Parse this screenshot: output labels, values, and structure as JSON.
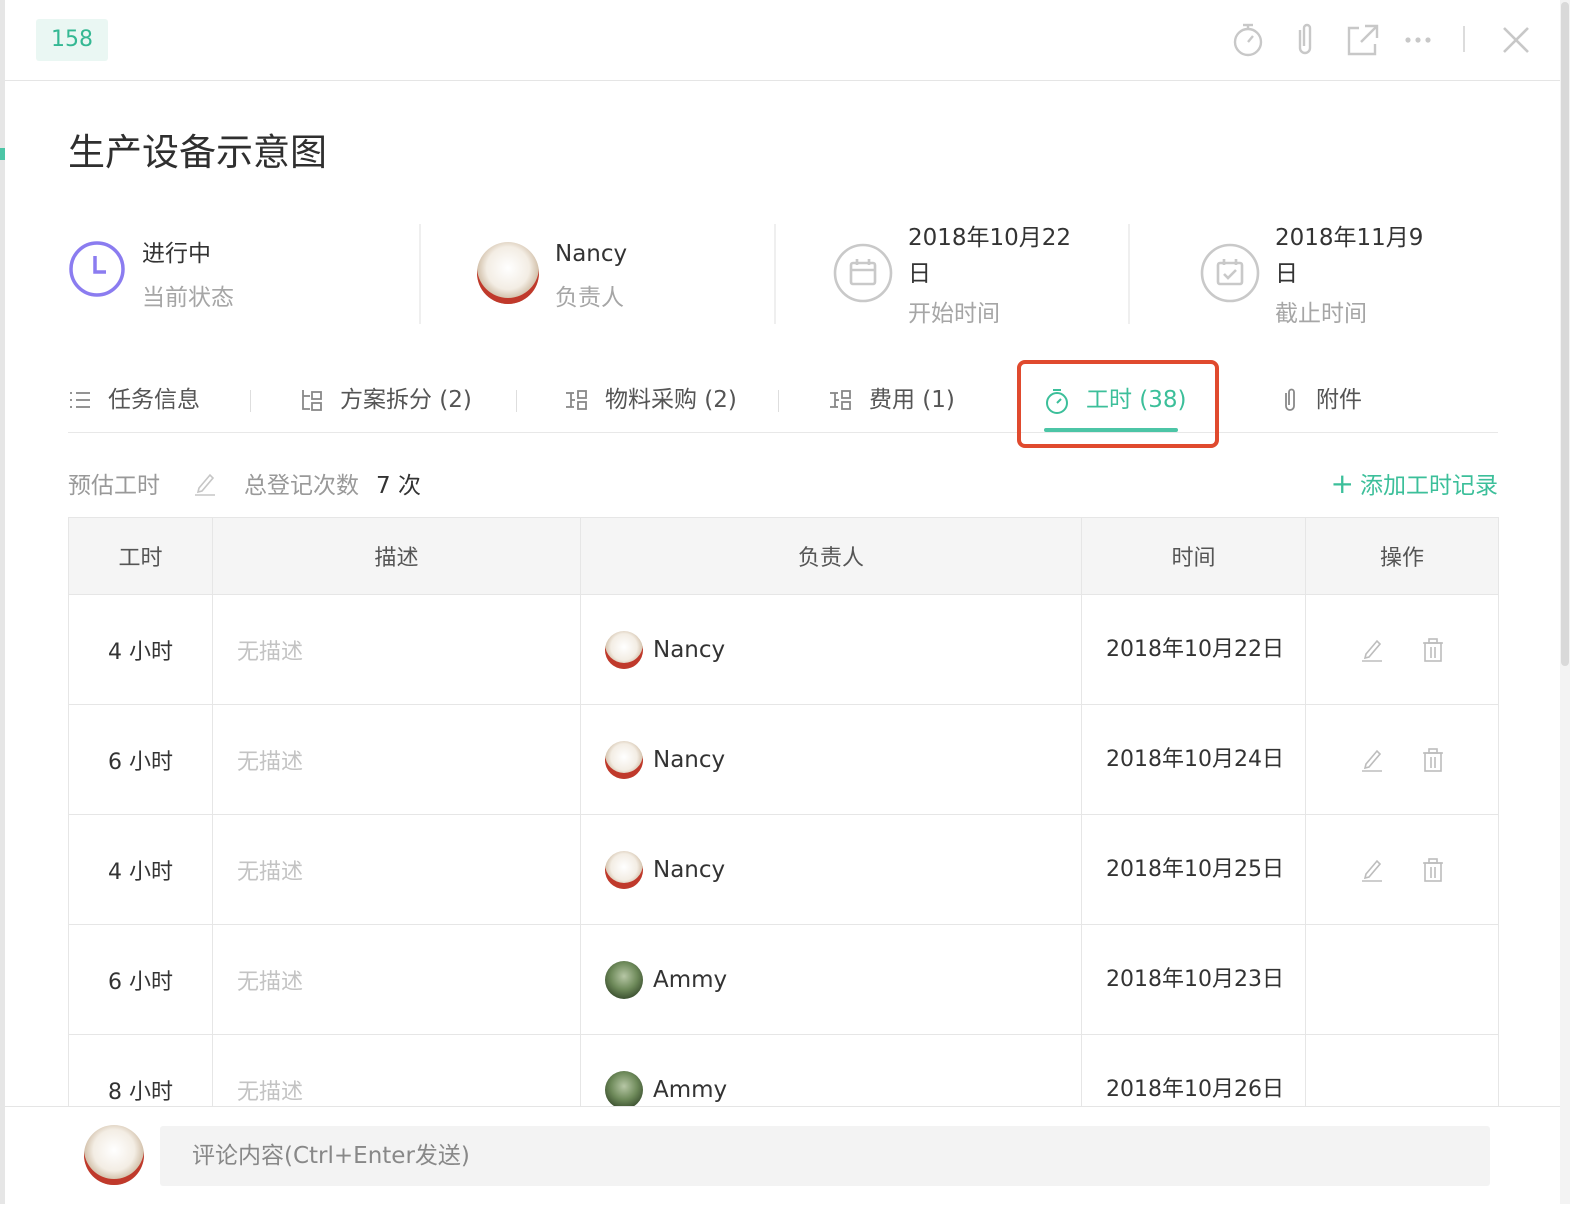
{
  "header": {
    "task_id": "158",
    "icons": [
      "stopwatch-icon",
      "paperclip-icon",
      "external-link-icon",
      "more-icon",
      "close-icon"
    ]
  },
  "task": {
    "title": "生产设备示意图"
  },
  "meta": {
    "status": {
      "value": "进行中",
      "label": "当前状态",
      "icon": "clock-icon",
      "color": "#8b7cf0"
    },
    "owner": {
      "value": "Nancy",
      "label": "负责人",
      "icon": "avatar"
    },
    "start": {
      "value": "2018年10月22日",
      "label": "开始时间",
      "icon": "calendar-icon"
    },
    "due": {
      "value": "2018年11月9日",
      "label": "截止时间",
      "icon": "calendar-check-icon"
    }
  },
  "tabs": [
    {
      "label": "任务信息",
      "icon": "list-icon",
      "active": false
    },
    {
      "label": "方案拆分 (2)",
      "icon": "split-icon",
      "active": false
    },
    {
      "label": "物料采购 (2)",
      "icon": "split-icon",
      "active": false
    },
    {
      "label": "费用 (1)",
      "icon": "split-icon",
      "active": false
    },
    {
      "label": "工时 (38)",
      "icon": "stopwatch-icon",
      "active": true
    },
    {
      "label": "附件",
      "icon": "paperclip-icon",
      "active": false
    }
  ],
  "summary": {
    "estimate_label": "预估工时",
    "total_label": "总登记次数",
    "total_value": "7 次",
    "add_link": "添加工时记录"
  },
  "table": {
    "columns": [
      "工时",
      "描述",
      "负责人",
      "时间",
      "操作"
    ],
    "rows": [
      {
        "hours": "4 小时",
        "desc": "无描述",
        "user": "Nancy",
        "time": "2018年10月22日",
        "editable": true
      },
      {
        "hours": "6 小时",
        "desc": "无描述",
        "user": "Nancy",
        "time": "2018年10月24日",
        "editable": true
      },
      {
        "hours": "4 小时",
        "desc": "无描述",
        "user": "Nancy",
        "time": "2018年10月25日",
        "editable": true
      },
      {
        "hours": "6 小时",
        "desc": "无描述",
        "user": "Ammy",
        "time": "2018年10月23日",
        "editable": false
      },
      {
        "hours": "8 小时",
        "desc": "无描述",
        "user": "Ammy",
        "time": "2018年10月26日",
        "editable": false
      }
    ]
  },
  "footer": {
    "comment_placeholder": "评论内容(Ctrl+Enter发送)"
  },
  "colors": {
    "accent": "#4cc5a6",
    "highlight_box": "#e04a2e",
    "status_purple": "#8b7cf0"
  }
}
